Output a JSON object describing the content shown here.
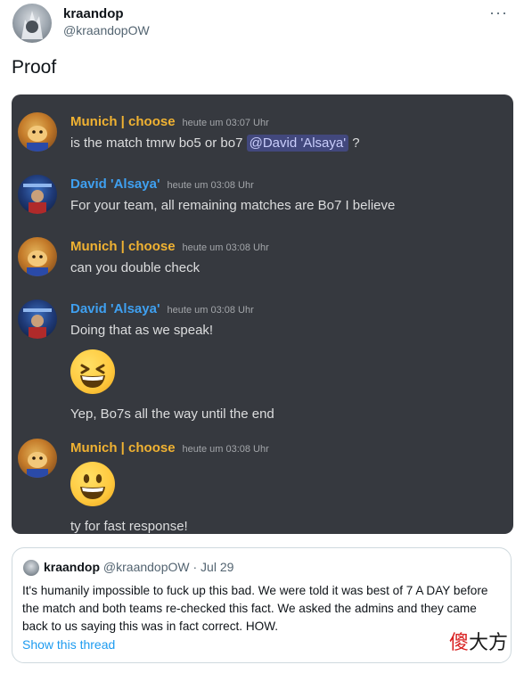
{
  "tweet": {
    "author_name": "kraandop",
    "author_handle": "@kraandopOW",
    "more_label": "···",
    "text": "Proof"
  },
  "discord": {
    "messages": [
      {
        "name": "Munich | choose",
        "time": "heute um 03:07 Uhr",
        "text_before": "is the match tmrw bo5 or bo7 ",
        "mention": "@David 'Alsaya'",
        "text_after": " ?"
      },
      {
        "name": "David 'Alsaya'",
        "time": "heute um 03:08 Uhr",
        "text": "For your team, all remaining matches are Bo7 I believe"
      },
      {
        "name": "Munich | choose",
        "time": "heute um 03:08 Uhr",
        "text": "can you double check"
      },
      {
        "name": "David 'Alsaya'",
        "time": "heute um 03:08 Uhr",
        "text": "Doing that as we speak!",
        "text2": "Yep, Bo7s all the way until the end",
        "emoji": "grinning-squinting-face"
      },
      {
        "name": "Munich | choose",
        "time": "heute um 03:08 Uhr",
        "text": "ty for fast response!",
        "emoji": "grinning-face"
      }
    ],
    "colors": {
      "background": "#36393f",
      "munich_name": "#f0b232",
      "david_name": "#3fa0f0",
      "text": "#dcddde"
    }
  },
  "quote": {
    "author_name": "kraandop",
    "author_handle": "@kraandopOW",
    "date": "· Jul 29",
    "text": "It's humanily impossible to fuck up this bad. We were told it was best of 7 A DAY before the match and both teams re-checked this fact. We asked the admins and they came back to us saying this was in fact correct. HOW.",
    "show_thread": "Show this thread"
  },
  "watermark": {
    "part1": "傻",
    "part2": "大方"
  }
}
